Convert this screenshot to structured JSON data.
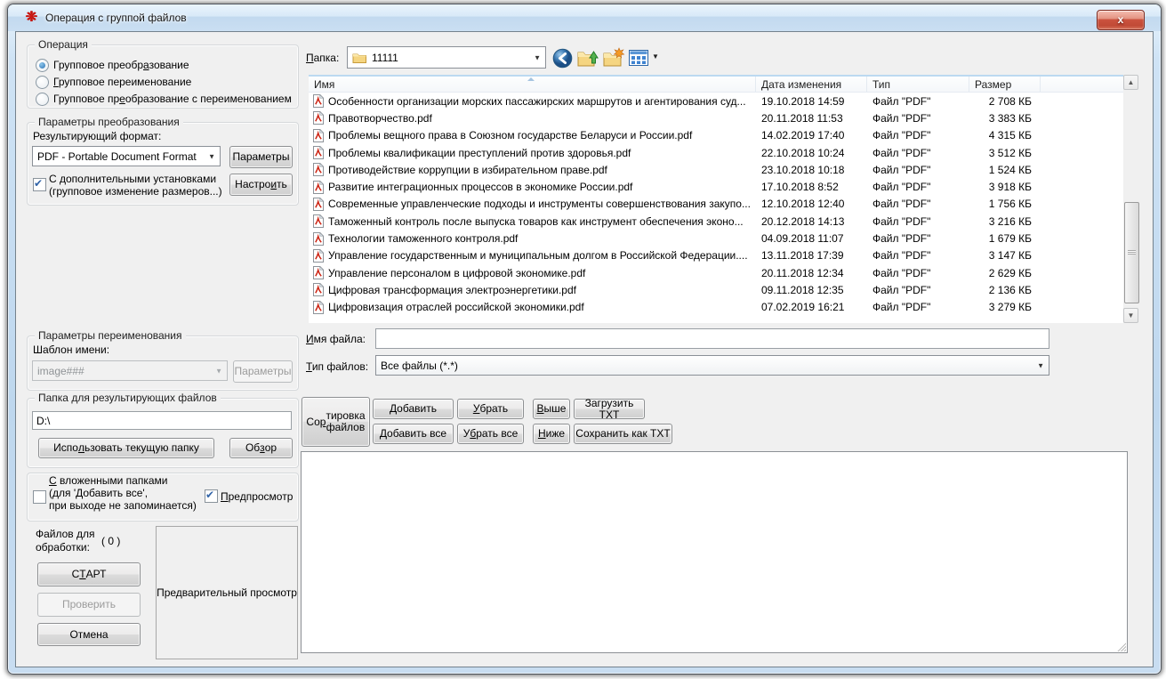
{
  "colors": {
    "frame_blue": "#bed7ee",
    "close_red": "#cc5340",
    "client_gray": "#f0f0f0",
    "header_blue_line": "#bcd9f1",
    "pdf_red": "#cc2211"
  },
  "icons": {
    "app": "❋",
    "close": "x",
    "dropdown": "▼",
    "scroll_up": "▲",
    "scroll_down": "▼",
    "views_caret": "▼"
  },
  "window": {
    "title": "Операция с группой файлов"
  },
  "operation": {
    "title": "Операция",
    "options": [
      {
        "label_html": "Групповое преобр<u>а</u>зование",
        "selected": true
      },
      {
        "label_html": "<u>Г</u>рупповое переименование",
        "selected": false
      },
      {
        "label_html": "Групповое пр<u>е</u>образование с переименованием",
        "selected": false
      }
    ]
  },
  "conversion": {
    "title": "Параметры преобразования",
    "format_label": "Результирующий формат:",
    "format_value": "PDF - Portable Document Format",
    "params_button": "Параметры",
    "extra_label_html": "С дополнительными установками<br>(групповое изменение размеров...)",
    "extra_checked": true,
    "configure_button_html": "Настро<u>и</u>ть"
  },
  "rename": {
    "title": "Параметры переименования",
    "template_label": "Шаблон имени:",
    "template_value": "image###",
    "params_button": "Параметры"
  },
  "output": {
    "title": "Папка для результирующих файлов",
    "path_value": "D:\\",
    "use_current_html": "Испо<u>л</u>ьзовать текущую папку",
    "browse_html": "Об<u>з</u>ор"
  },
  "options": {
    "nested_html": "<u>С</u> вложенными папками<br>(для 'Добавить все',<br>при выходе не запоминается)",
    "nested_checked": false,
    "preview_html": "<u>П</u>редпросмотр",
    "preview_checked": true
  },
  "process": {
    "count_label": "Файлов для\nобработки:",
    "count_value": "( 0 )",
    "start_html": "С<u>Т</u>АРТ",
    "check_label": "Проверить",
    "cancel_label": "Отмена",
    "preview_label": "Предварительный просмотр"
  },
  "browser": {
    "folder_label_html": "<u>П</u>апка:",
    "folder_value": "11111",
    "toolbar_buttons": [
      "back",
      "folder-up",
      "new-folder",
      "views"
    ],
    "columns": [
      "Имя",
      "Дата изменения",
      "Тип",
      "Размер"
    ],
    "files": [
      {
        "name": "Особенности организации морских пассажирских маршрутов и агентирования суд...",
        "date": "19.10.2018 14:59",
        "type": "Файл \"PDF\"",
        "size": "2 708 КБ"
      },
      {
        "name": "Правотворчество.pdf",
        "date": "20.11.2018 11:53",
        "type": "Файл \"PDF\"",
        "size": "3 383 КБ"
      },
      {
        "name": "Проблемы вещного права в Союзном государстве Беларуси и России.pdf",
        "date": "14.02.2019 17:40",
        "type": "Файл \"PDF\"",
        "size": "4 315 КБ"
      },
      {
        "name": "Проблемы квалификации преступлений против здоровья.pdf",
        "date": "22.10.2018 10:24",
        "type": "Файл \"PDF\"",
        "size": "3 512 КБ"
      },
      {
        "name": "Противодействие коррупции в избирательном праве.pdf",
        "date": "23.10.2018 10:18",
        "type": "Файл \"PDF\"",
        "size": "1 524 КБ"
      },
      {
        "name": "Развитие интеграционных процессов в экономике России.pdf",
        "date": "17.10.2018 8:52",
        "type": "Файл \"PDF\"",
        "size": "3 918 КБ"
      },
      {
        "name": "Современные управленческие подходы и инструменты совершенствования закупо...",
        "date": "12.10.2018 12:40",
        "type": "Файл \"PDF\"",
        "size": "1 756 КБ"
      },
      {
        "name": "Таможенный контроль после выпуска товаров как инструмент обеспечения эконо...",
        "date": "20.12.2018 14:13",
        "type": "Файл \"PDF\"",
        "size": "3 216 КБ"
      },
      {
        "name": "Технологии таможенного контроля.pdf",
        "date": "04.09.2018 11:07",
        "type": "Файл \"PDF\"",
        "size": "1 679 КБ"
      },
      {
        "name": "Управление государственным и муниципальным долгом в Российской Федерации....",
        "date": "13.11.2018 17:39",
        "type": "Файл \"PDF\"",
        "size": "3 147 КБ"
      },
      {
        "name": "Управление персоналом в цифровой экономике.pdf",
        "date": "20.11.2018 12:34",
        "type": "Файл \"PDF\"",
        "size": "2 629 КБ"
      },
      {
        "name": "Цифровая трансформация электроэнергетики.pdf",
        "date": "09.11.2018 12:35",
        "type": "Файл \"PDF\"",
        "size": "2 136 КБ"
      },
      {
        "name": "Цифровизация отраслей российской экономики.pdf",
        "date": "07.02.2019 16:21",
        "type": "Файл \"PDF\"",
        "size": "3 279 КБ"
      }
    ],
    "filename_label_html": "<u>И</u>мя файла:",
    "filename_value": "",
    "filetype_label_html": "<u>Т</u>ип файлов:",
    "filetype_value": "Все файлы (*.*)"
  },
  "listops": {
    "sort_html": "Со<u>р</u>тировка<br>файлов",
    "add_html": "<u>Д</u>обавить",
    "remove_html": "<u>У</u>брать",
    "up_html": "<u>В</u>ыше",
    "load_txt_label": "Загрузить TXT",
    "add_all_html": "<u>Д</u>обавить все",
    "remove_all_html": "У<u>б</u>рать все",
    "down_html": "<u>Н</u>иже",
    "save_txt_label": "Сохранить как TXT"
  }
}
